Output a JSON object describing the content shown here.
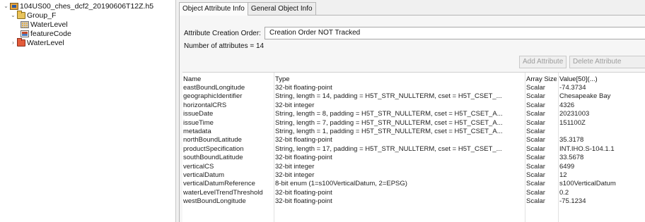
{
  "tree": {
    "root": "104US00_ches_dcf2_20190606T12Z.h5",
    "group_f": "Group_F",
    "water_level_child": "WaterLevel",
    "feature_code": "featureCode",
    "water_level_group": "WaterLevel"
  },
  "tabs": [
    "Object Attribute Info",
    "General Object Info"
  ],
  "attr_order": {
    "label": "Attribute Creation Order:",
    "value": "Creation Order NOT Tracked"
  },
  "num_attrs": "Number of attributes = 14",
  "buttons": {
    "add": "Add Attribute",
    "delete": "Delete Attribute"
  },
  "table": {
    "headers": [
      "Name",
      "Type",
      "Array Size",
      "Value[50](...)"
    ],
    "rows": [
      [
        "eastBoundLongitude",
        "32-bit floating-point",
        "Scalar",
        "-74.3734"
      ],
      [
        "geographicIdentifier",
        "String, length = 14, padding = H5T_STR_NULLTERM, cset = H5T_CSET_...",
        "Scalar",
        "Chesapeake Bay"
      ],
      [
        "horizontalCRS",
        "32-bit integer",
        "Scalar",
        "4326"
      ],
      [
        "issueDate",
        "String, length = 8, padding = H5T_STR_NULLTERM, cset = H5T_CSET_A...",
        "Scalar",
        "20231003"
      ],
      [
        "issueTime",
        "String, length = 7, padding = H5T_STR_NULLTERM, cset = H5T_CSET_A...",
        "Scalar",
        "151100Z"
      ],
      [
        "metadata",
        "String, length = 1, padding = H5T_STR_NULLTERM, cset = H5T_CSET_A...",
        "Scalar",
        ""
      ],
      [
        "northBoundLatitude",
        "32-bit floating-point",
        "Scalar",
        "35.3178"
      ],
      [
        "productSpecification",
        "String, length = 17, padding = H5T_STR_NULLTERM, cset = H5T_CSET_...",
        "Scalar",
        "INT.IHO.S-104.1.1"
      ],
      [
        "southBoundLatitude",
        "32-bit floating-point",
        "Scalar",
        "33.5678"
      ],
      [
        "verticalCS",
        "32-bit integer",
        "Scalar",
        "6499"
      ],
      [
        "verticalDatum",
        "32-bit integer",
        "Scalar",
        "12"
      ],
      [
        "verticalDatumReference",
        "8-bit enum (1=s100VerticalDatum, 2=EPSG)",
        "Scalar",
        "s100VerticalDatum"
      ],
      [
        "waterLevelTrendThreshold",
        "32-bit floating-point",
        "Scalar",
        "0.2"
      ],
      [
        "westBoundLongitude",
        "32-bit floating-point",
        "Scalar",
        "-75.1234"
      ]
    ]
  }
}
